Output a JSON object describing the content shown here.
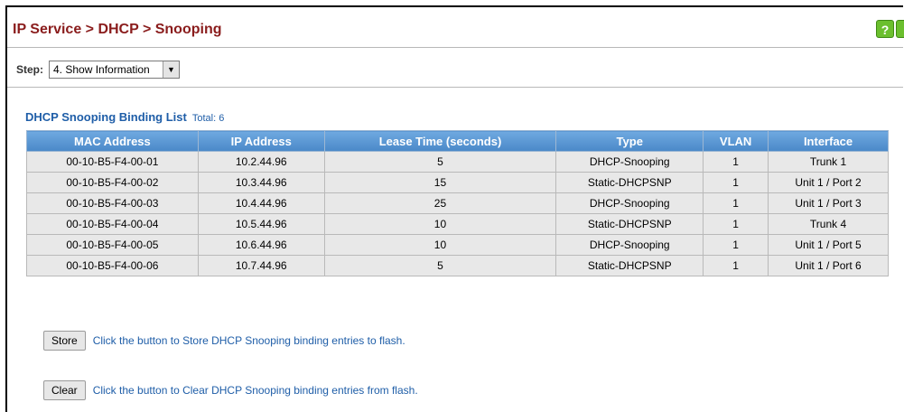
{
  "header": {
    "title": "IP Service > DHCP > Snooping"
  },
  "step": {
    "label": "Step:",
    "selected": "4. Show Information"
  },
  "binding_list": {
    "title": "DHCP Snooping Binding List",
    "total": "Total: 6",
    "columns": [
      "MAC Address",
      "IP Address",
      "Lease Time (seconds)",
      "Type",
      "VLAN",
      "Interface"
    ],
    "rows": [
      [
        "00-10-B5-F4-00-01",
        "10.2.44.96",
        "5",
        "DHCP-Snooping",
        "1",
        "Trunk 1"
      ],
      [
        "00-10-B5-F4-00-02",
        "10.3.44.96",
        "15",
        "Static-DHCPSNP",
        "1",
        "Unit 1 / Port 2"
      ],
      [
        "00-10-B5-F4-00-03",
        "10.4.44.96",
        "25",
        "DHCP-Snooping",
        "1",
        "Unit 1 / Port 3"
      ],
      [
        "00-10-B5-F4-00-04",
        "10.5.44.96",
        "10",
        "Static-DHCPSNP",
        "1",
        "Trunk 4"
      ],
      [
        "00-10-B5-F4-00-05",
        "10.6.44.96",
        "10",
        "DHCP-Snooping",
        "1",
        "Unit 1 / Port 5"
      ],
      [
        "00-10-B5-F4-00-06",
        "10.7.44.96",
        "5",
        "Static-DHCPSNP",
        "1",
        "Unit 1 / Port 6"
      ]
    ]
  },
  "actions": {
    "store": {
      "label": "Store",
      "description": "Click the button to Store DHCP Snooping binding entries to flash."
    },
    "clear": {
      "label": "Clear",
      "description": "Click the button to Clear DHCP Snooping binding entries from flash."
    }
  },
  "icons": {
    "help": "help-icon",
    "next": "next-icon"
  },
  "colors": {
    "title": "#8a1c1c",
    "accent": "#1f5ea8",
    "header_bg": "#5b9bd5",
    "row_bg": "#e8e8e8"
  }
}
